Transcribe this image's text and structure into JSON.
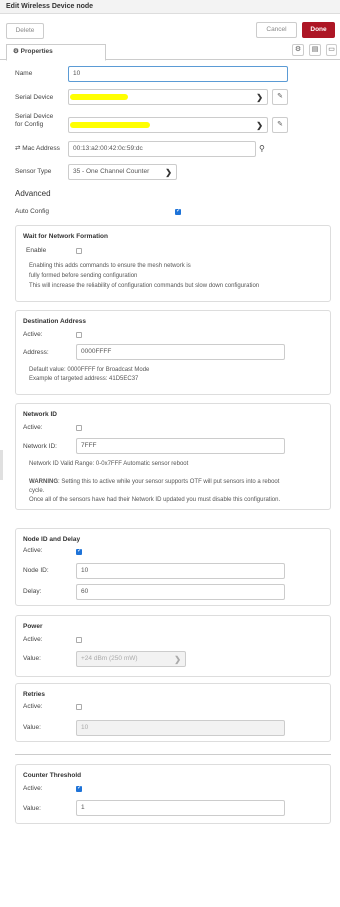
{
  "window": {
    "title": "Edit Wireless Device node"
  },
  "toolbar": {
    "delete_label": "Delete",
    "cancel_label": "Cancel",
    "done_label": "Done"
  },
  "tabs": {
    "properties_label": "Properties",
    "icons": [
      "gear-icon",
      "description-icon",
      "appearance-icon"
    ]
  },
  "form": {
    "name": {
      "label": "Name",
      "value": "10"
    },
    "serial_device": {
      "label": "Serial Device"
    },
    "serial_device_config": {
      "label_line1": "Serial Device",
      "label_line2": "for Config"
    },
    "mac_address": {
      "label": "Mac Address",
      "value": "00:13:a2:00:42:0c:59:dc"
    },
    "sensor_type": {
      "label": "Sensor Type",
      "value": "35 - One Channel Counter"
    }
  },
  "advanced": {
    "title": "Advanced",
    "auto_config": {
      "label": "Auto Config",
      "checked": true
    }
  },
  "panels": {
    "wait_network": {
      "title": "Wait for Network Formation",
      "enable_label": "Enable",
      "enabled": false,
      "help1": "Enabling this adds commands to ensure the mesh network is",
      "help2": "fully formed before sending configuration",
      "help3": "This will increase the reliability of configuration commands but slow down configuration"
    },
    "destination": {
      "title": "Destination Address",
      "active_label": "Active:",
      "active": false,
      "address_label": "Address:",
      "address_value": "0000FFFF",
      "help1": "Default value: 0000FFFF for Broadcast Mode",
      "help2": "Example of targeted address: 41D5EC37"
    },
    "network_id": {
      "title": "Network ID",
      "active_label": "Active:",
      "active": false,
      "id_label": "Network ID:",
      "id_value": "7FFF",
      "help1": "Network ID Valid Range: 0-0x7FFF Automatic sensor reboot",
      "warning_bold": "WARNING",
      "warning_text": ": Setting this to active while your sensor supports OTF will put sensors into a reboot",
      "warning_line2": "cycle.",
      "warning_line3": "Once all of the sensors have had their Network ID updated you must disable this configuration."
    },
    "node_id": {
      "title": "Node ID and Delay",
      "active_label": "Active:",
      "active": true,
      "node_label": "Node ID:",
      "node_value": "10",
      "delay_label": "Delay:",
      "delay_value": "60"
    },
    "power": {
      "title": "Power",
      "active_label": "Active:",
      "active": false,
      "value_label": "Value:",
      "value": "+24 dBm (250 mW)"
    },
    "retries": {
      "title": "Retries",
      "active_label": "Active:",
      "active": false,
      "value_label": "Value:",
      "value": "10"
    },
    "counter": {
      "title": "Counter Threshold",
      "active_label": "Active:",
      "active": true,
      "value_label": "Value:",
      "value": "1"
    }
  },
  "colors": {
    "done": "#ad1625",
    "checkbox": "#1e73d8",
    "redaction": "#ffff00"
  }
}
